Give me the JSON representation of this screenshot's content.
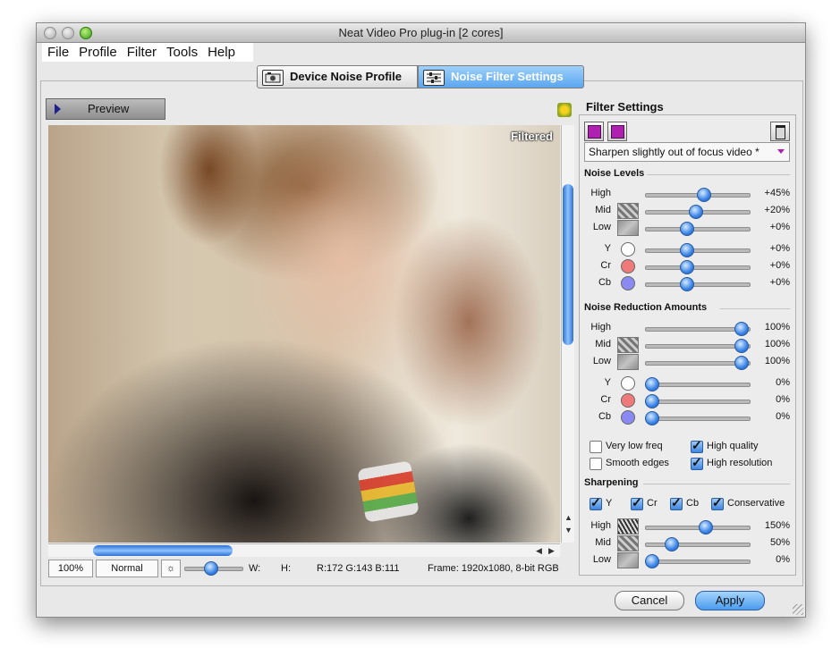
{
  "window": {
    "title": "Neat Video Pro plug-in [2 cores]"
  },
  "menu": [
    {
      "label": "File"
    },
    {
      "label": "Profile"
    },
    {
      "label": "Filter"
    },
    {
      "label": "Tools"
    },
    {
      "label": "Help"
    }
  ],
  "tabs": {
    "device": {
      "label": "Device Noise Profile",
      "icon": "camera-icon",
      "selected": false
    },
    "filter": {
      "label": "Noise Filter Settings",
      "icon": "sliders-icon",
      "selected": true
    }
  },
  "preview": {
    "button_label": "Preview",
    "overlay_label": "Filtered",
    "zoom": "100%",
    "mode": "Normal",
    "w_label": "W:",
    "h_label": "H:",
    "pixel_info": "R:172 G:143 B:111",
    "frame_info": "Frame: 1920x1080, 8-bit RGB",
    "brightness_level": 0.45
  },
  "filter_settings": {
    "title": "Filter Settings",
    "preset": "Sharpen slightly out of focus video *",
    "noise_levels": {
      "title": "Noise Levels",
      "rows": [
        {
          "label": "High",
          "value": "+45%",
          "pos": 0.56
        },
        {
          "label": "Mid",
          "value": "+20%",
          "pos": 0.48
        },
        {
          "label": "Low",
          "value": "+0%",
          "pos": 0.4
        },
        {
          "label": "Y",
          "value": "+0%",
          "pos": 0.4
        },
        {
          "label": "Cr",
          "value": "+0%",
          "pos": 0.4
        },
        {
          "label": "Cb",
          "value": "+0%",
          "pos": 0.4
        }
      ]
    },
    "reduction": {
      "title": "Noise Reduction Amounts",
      "rows": [
        {
          "label": "High",
          "value": "100%",
          "pos": 0.92
        },
        {
          "label": "Mid",
          "value": "100%",
          "pos": 0.92
        },
        {
          "label": "Low",
          "value": "100%",
          "pos": 0.92
        },
        {
          "label": "Y",
          "value": "0%",
          "pos": 0.06
        },
        {
          "label": "Cr",
          "value": "0%",
          "pos": 0.06
        },
        {
          "label": "Cb",
          "value": "0%",
          "pos": 0.06
        }
      ]
    },
    "options": {
      "very_low_freq": {
        "label": "Very low freq",
        "checked": false
      },
      "high_quality": {
        "label": "High quality",
        "checked": true
      },
      "smooth_edges": {
        "label": "Smooth edges",
        "checked": false
      },
      "high_resolution": {
        "label": "High resolution",
        "checked": true
      }
    },
    "sharpening": {
      "title": "Sharpening",
      "channels": {
        "y": {
          "label": "Y",
          "checked": true
        },
        "cr": {
          "label": "Cr",
          "checked": true
        },
        "cb": {
          "label": "Cb",
          "checked": true
        },
        "conservative": {
          "label": "Conservative",
          "checked": true
        }
      },
      "rows": [
        {
          "label": "High",
          "value": "150%",
          "pos": 0.58
        },
        {
          "label": "Mid",
          "value": "50%",
          "pos": 0.25
        },
        {
          "label": "Low",
          "value": "0%",
          "pos": 0.06
        }
      ]
    }
  },
  "colors": {
    "y": "#ffffff",
    "cr": "#f07a7a",
    "cb": "#8a8af2",
    "accent": "#4a9cef"
  },
  "buttons": {
    "cancel": "Cancel",
    "apply": "Apply"
  }
}
